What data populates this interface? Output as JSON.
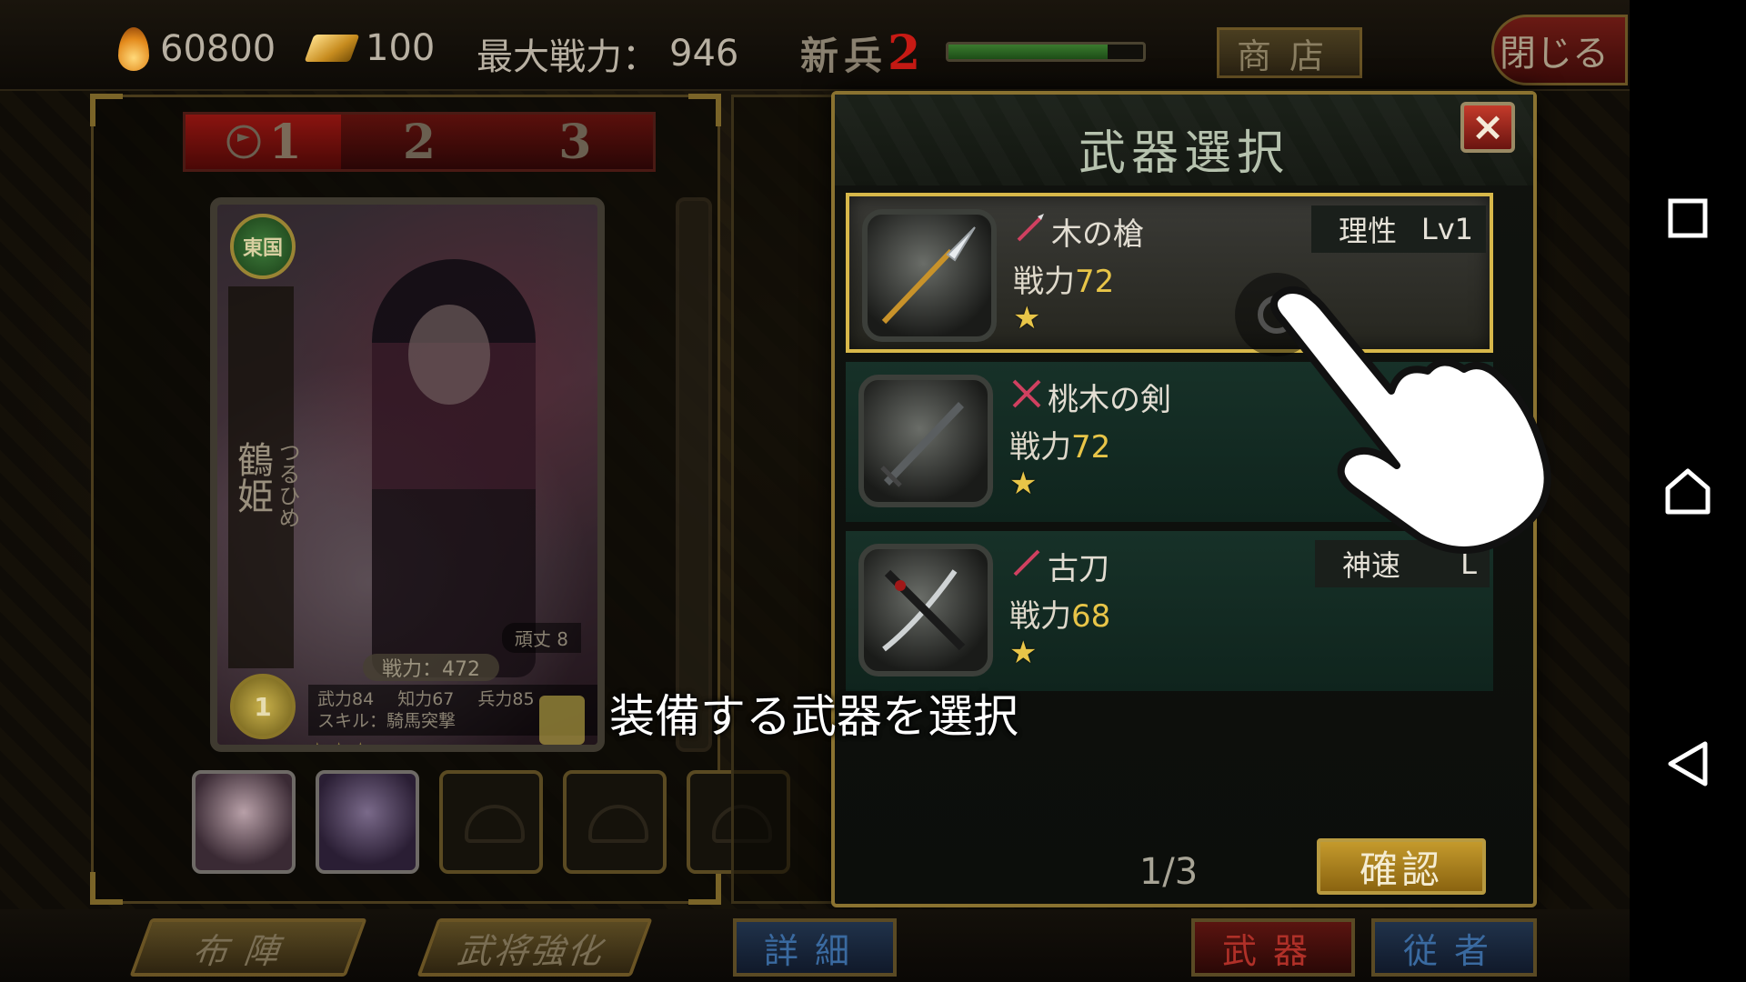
{
  "top_bar": {
    "fire_resource": "60800",
    "gold_resource": "100",
    "max_power_label": "最大戦力：",
    "max_power_value": "946",
    "rank_label": "新兵",
    "rank_level": "2",
    "xp_progress": 0.82,
    "shop_button": "商店",
    "close_button": "閉じる"
  },
  "party_tabs": [
    "1",
    "2",
    "3"
  ],
  "active_party_tab": 0,
  "card": {
    "faction": "東国",
    "name": "鶴姫",
    "reading": "つるひめ",
    "hardiness": "頑丈 8",
    "power": "戦力：472",
    "stats": {
      "bu": "武力84",
      "chi": "知力67",
      "hei": "兵力85"
    },
    "skill": "スキル：騎馬突撃",
    "rank": "1",
    "stars": "★★★"
  },
  "modal": {
    "title": "武器選択",
    "close_symbol": "×",
    "weapons": [
      {
        "name": "木の槍",
        "power_label": "戦力",
        "power": "72",
        "stars": "★",
        "attr": "理性",
        "level": "Lv1",
        "selected": true,
        "icon": "spear-icon"
      },
      {
        "name": "桃木の剣",
        "power_label": "戦力",
        "power": "72",
        "stars": "★",
        "attr": "",
        "level": "",
        "selected": false,
        "icon": "crossed-swords-icon"
      },
      {
        "name": "古刀",
        "power_label": "戦力",
        "power": "68",
        "stars": "★",
        "attr": "神速",
        "level": "L",
        "selected": false,
        "icon": "katana-icon"
      }
    ],
    "pager": "1/3",
    "confirm": "確認"
  },
  "hint": "装備する武器を選択",
  "bottom_buttons": {
    "formation": "布陣",
    "strengthen": "武将強化",
    "detail": "詳細",
    "weapon": "武器",
    "follower": "従者"
  },
  "colors": {
    "accent_gold": "#d7b84a",
    "power_number": "#e8c548",
    "danger_red": "#c43a2a"
  },
  "android_nav": [
    "recent-apps-icon",
    "home-icon",
    "back-icon"
  ]
}
